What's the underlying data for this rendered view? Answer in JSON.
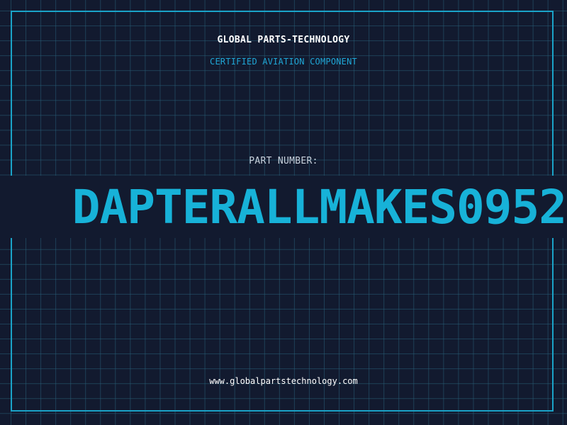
{
  "header": {
    "company": "GLOBAL PARTS-TECHNOLOGY",
    "subtitle": "CERTIFIED AVIATION COMPONENT"
  },
  "part": {
    "label": "PART NUMBER:",
    "number_visible": "DAPTERALLMAKES0952"
  },
  "footer": {
    "url": "www.globalpartstechnology.com"
  },
  "colors": {
    "background": "#121a2f",
    "grid": "#285f78",
    "accent": "#1aa3c8",
    "part_number": "#17b2d8",
    "text": "#ffffff"
  }
}
